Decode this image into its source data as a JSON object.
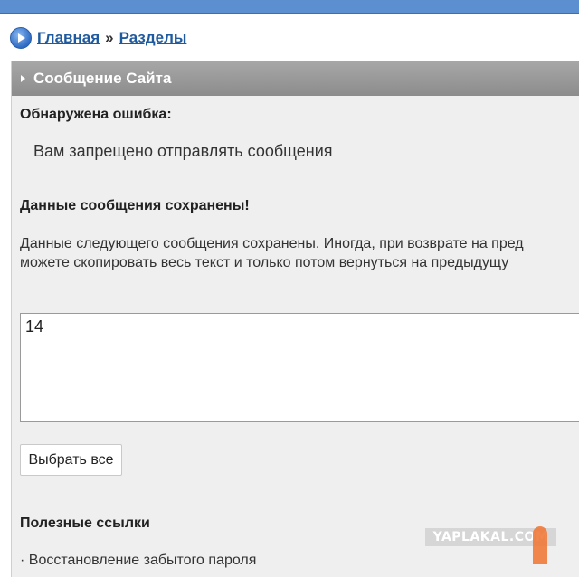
{
  "breadcrumb": {
    "home": "Главная",
    "separator": "»",
    "sections": "Разделы"
  },
  "panel": {
    "title": "Сообщение Сайта",
    "error_heading": "Обнаружена ошибка:",
    "error_message": "Вам запрещено отправлять сообщения",
    "saved_heading": "Данные сообщения сохранены!",
    "saved_desc_line1": "Данные следующего сообщения сохранены. Иногда, при возврате на пред",
    "saved_desc_line2": "можете скопировать весь текст и только потом вернуться на предыдущу",
    "saved_text": "14",
    "select_all_button": "Выбрать все",
    "useful_links_heading": "Полезные ссылки",
    "useful_link_1": "· Восстановление забытого пароля"
  },
  "watermark": "YAPLAKAL.COM",
  "colors": {
    "topbar": "#5b8fd0",
    "link": "#1f5a9e",
    "panel_header": "#999999",
    "panel_bg": "#efefef"
  }
}
